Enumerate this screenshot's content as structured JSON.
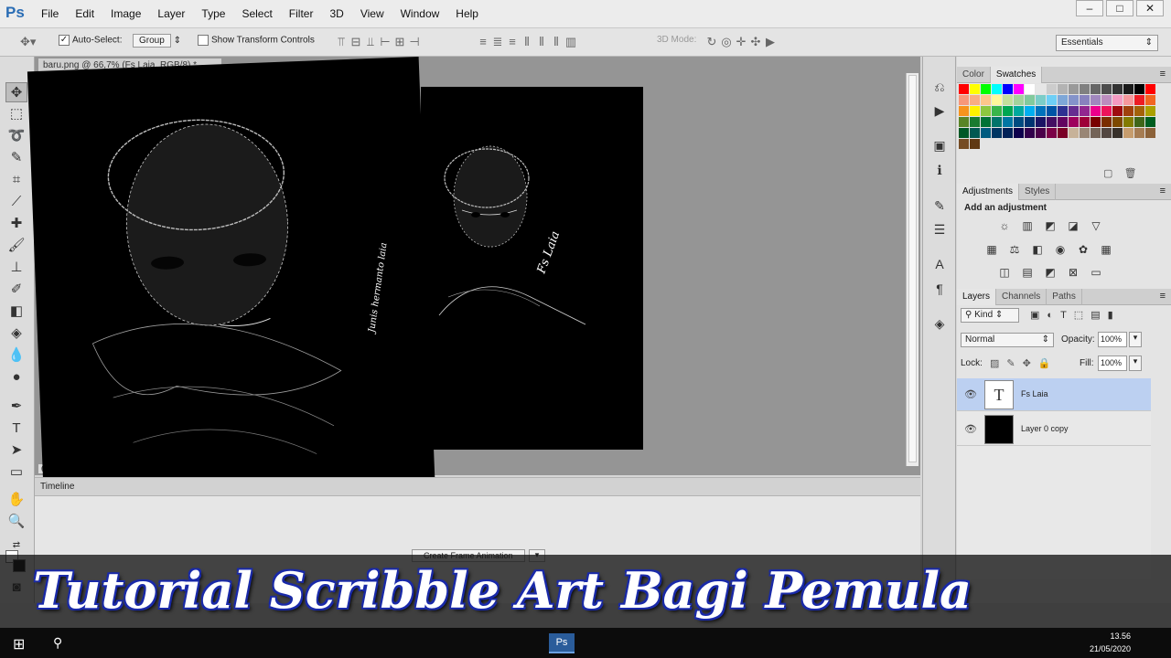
{
  "app": {
    "logo": "Ps",
    "menus": [
      "File",
      "Edit",
      "Image",
      "Layer",
      "Type",
      "Select",
      "Filter",
      "3D",
      "View",
      "Window",
      "Help"
    ],
    "window_controls": [
      "–",
      "□",
      "✕"
    ]
  },
  "options_bar": {
    "auto_select_label": "Auto-Select:",
    "auto_select_value": "Group",
    "show_transform_label": "Show Transform Controls",
    "mode_label": "3D Mode:",
    "workspace": "Essentials"
  },
  "document": {
    "tab_title": "baru.png @ 66,7% (Fs  Laia, RGB/8) *",
    "zoom": "66"
  },
  "timeline": {
    "title": "Timeline",
    "create_button": "Create Frame Animation"
  },
  "panels": {
    "color_tabs": [
      "Color",
      "Swatches"
    ],
    "adjust_tabs": [
      "Adjustments",
      "Styles"
    ],
    "add_adjustment": "Add an adjustment",
    "layers_tabs": [
      "Layers",
      "Channels",
      "Paths"
    ],
    "kind_label": "Kind",
    "blend_mode": "Normal",
    "opacity_label": "Opacity:",
    "opacity_value": "100%",
    "lock_label": "Lock:",
    "fill_label": "Fill:",
    "fill_value": "100%"
  },
  "layers": [
    {
      "name": "Fs   Laia",
      "thumb": "T",
      "selected": true
    },
    {
      "name": "Layer 0 copy",
      "thumb": "",
      "selected": false
    }
  ],
  "canvas_texts": {
    "small_signature": "Fs  Laia",
    "large_signature": "Junis hermanto laia"
  },
  "swatch_colors": [
    "#ff0000",
    "#ffff00",
    "#00ff00",
    "#00ffff",
    "#0000ff",
    "#ff00ff",
    "#ffffff",
    "#e6e6e6",
    "#cccccc",
    "#b3b3b3",
    "#999999",
    "#808080",
    "#666666",
    "#4d4d4d",
    "#333333",
    "#1a1a1a",
    "#000000",
    "#ff0000",
    "#f7977a",
    "#f9ad81",
    "#fdc68a",
    "#fff79a",
    "#c4df9b",
    "#a3d39c",
    "#82ca9d",
    "#7bcdc8",
    "#6ecff6",
    "#7ea7d8",
    "#8493ca",
    "#8882be",
    "#a187be",
    "#bc8dbf",
    "#f49ac2",
    "#f6989d",
    "#ed1c24",
    "#f26522",
    "#f7941d",
    "#fff200",
    "#8dc73f",
    "#39b54a",
    "#00a651",
    "#00a99d",
    "#00aeef",
    "#0072bc",
    "#0054a6",
    "#2e3192",
    "#662d91",
    "#92278f",
    "#ec008c",
    "#ed145b",
    "#9e0b0f",
    "#a0410d",
    "#a36209",
    "#aba000",
    "#598527",
    "#1a7b30",
    "#007236",
    "#00746b",
    "#0076a3",
    "#004b80",
    "#003471",
    "#1b1464",
    "#440e62",
    "#630460",
    "#9e005d",
    "#9e0039",
    "#790000",
    "#7b2e00",
    "#7d4900",
    "#827b00",
    "#406618",
    "#005e20",
    "#005826",
    "#005952",
    "#005b7f",
    "#003663",
    "#002157",
    "#0d004c",
    "#32004b",
    "#4b0049",
    "#7b0046",
    "#7a0026",
    "#c7b299",
    "#998675",
    "#736357",
    "#534741",
    "#37302a",
    "#c69c6d",
    "#a67c52",
    "#8c6239",
    "#754c24",
    "#603913"
  ],
  "taskbar": {
    "time": "13.56",
    "date": "21/05/2020"
  },
  "banner_title": "Tutorial Scribble Art Bagi Pemula"
}
